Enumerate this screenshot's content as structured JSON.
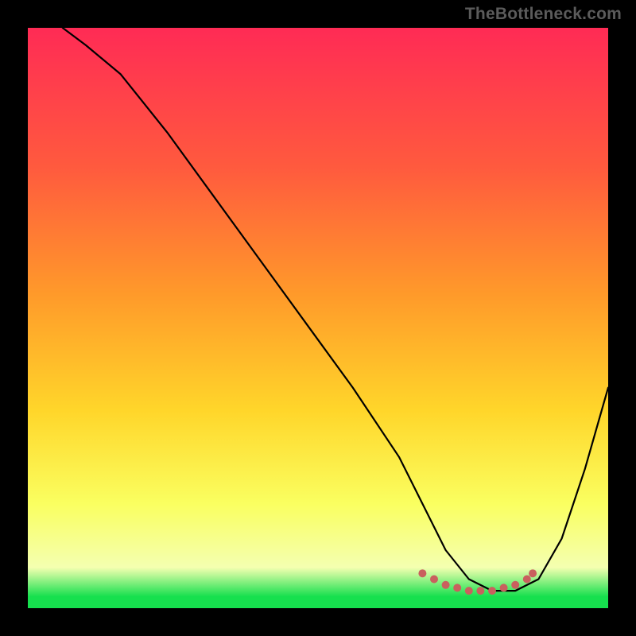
{
  "watermark": "TheBottleneck.com",
  "colors": {
    "black": "#000000",
    "gradient_top": "#ff2b55",
    "gradient_1": "#ff5a3e",
    "gradient_2": "#ff9a2a",
    "gradient_3": "#ffd62a",
    "gradient_4": "#faff60",
    "gradient_5": "#f4ffb0",
    "gradient_bottom": "#16e04e",
    "curve": "#000000",
    "dots": "#c9605e"
  },
  "chart_data": {
    "type": "line",
    "title": "",
    "xlabel": "",
    "ylabel": "",
    "xlim": [
      0,
      100
    ],
    "ylim": [
      0,
      100
    ],
    "grid": false,
    "legend": false,
    "series": [
      {
        "name": "bottleneck-curve",
        "x": [
          6,
          10,
          16,
          24,
          32,
          40,
          48,
          56,
          64,
          68,
          72,
          76,
          80,
          84,
          88,
          92,
          96,
          100
        ],
        "y": [
          100,
          97,
          92,
          82,
          71,
          60,
          49,
          38,
          26,
          18,
          10,
          5,
          3,
          3,
          5,
          12,
          24,
          38
        ]
      }
    ],
    "annotations": [
      {
        "name": "min-band-dots",
        "type": "scatter",
        "x": [
          68,
          70,
          72,
          74,
          76,
          78,
          80,
          82,
          84,
          86,
          87
        ],
        "y": [
          6,
          5,
          4,
          3.5,
          3,
          3,
          3,
          3.5,
          4,
          5,
          6
        ]
      }
    ]
  }
}
